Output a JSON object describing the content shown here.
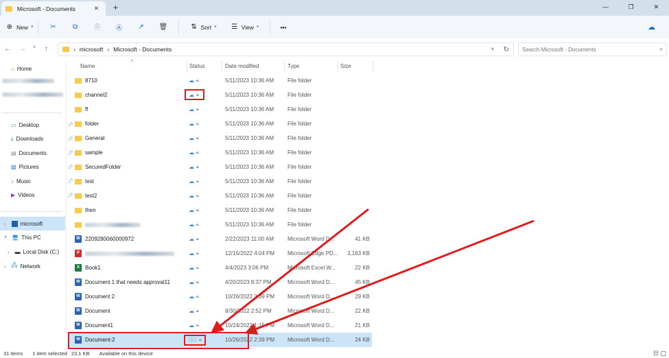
{
  "window": {
    "tab_title": "Microsoft - Documents",
    "new_tab": "+",
    "min": "—",
    "max": "❐",
    "close": "✕"
  },
  "toolbar": {
    "new": "New",
    "sort": "Sort",
    "view": "View",
    "more": "•••"
  },
  "address": {
    "crumbs": [
      "microsoft",
      "Microsoft - Documents"
    ],
    "search_placeholder": "Search Microsoft - Documents"
  },
  "sidebar": {
    "home": "Home",
    "quick": [
      {
        "label": "Desktop",
        "color": "#2a8ad8"
      },
      {
        "label": "Downloads",
        "color": "#1a9e6a"
      },
      {
        "label": "Documents",
        "color": "#7a8a9c"
      },
      {
        "label": "Pictures",
        "color": "#1f6fd0"
      },
      {
        "label": "Music",
        "color": "#e0603a"
      },
      {
        "label": "Videos",
        "color": "#8a3fd0"
      }
    ],
    "microsoft": "microsoft",
    "thispc": "This PC",
    "localdisk": "Local Disk (C:)",
    "network": "Network"
  },
  "columns": {
    "name": "Name",
    "status": "Status",
    "date": "Date modified",
    "type": "Type",
    "size": "Size"
  },
  "files": [
    {
      "name": "8710",
      "date": "5/11/2023 10:36 AM",
      "type": "File folder",
      "size": "",
      "kind": "folder"
    },
    {
      "name": "channel2",
      "date": "5/11/2023 10:36 AM",
      "type": "File folder",
      "size": "",
      "kind": "folder"
    },
    {
      "name": "ff",
      "date": "5/11/2023 10:36 AM",
      "type": "File folder",
      "size": "",
      "kind": "folder"
    },
    {
      "name": "folder",
      "date": "5/11/2023 10:36 AM",
      "type": "File folder",
      "size": "",
      "kind": "folder"
    },
    {
      "name": "General",
      "date": "5/11/2023 10:36 AM",
      "type": "File folder",
      "size": "",
      "kind": "folder"
    },
    {
      "name": "sample",
      "date": "5/11/2023 10:36 AM",
      "type": "File folder",
      "size": "",
      "kind": "folder"
    },
    {
      "name": "SecuredFolder",
      "date": "5/11/2023 10:36 AM",
      "type": "File folder",
      "size": "",
      "kind": "folder"
    },
    {
      "name": "test",
      "date": "5/11/2023 10:36 AM",
      "type": "File folder",
      "size": "",
      "kind": "folder"
    },
    {
      "name": "test2",
      "date": "5/11/2023 10:36 AM",
      "type": "File folder",
      "size": "",
      "kind": "folder"
    },
    {
      "name": "then",
      "date": "5/11/2023 10:36 AM",
      "type": "File folder",
      "size": "",
      "kind": "folder"
    },
    {
      "name": "",
      "date": "5/11/2023 10:36 AM",
      "type": "File folder",
      "size": "",
      "kind": "folder"
    },
    {
      "name": "2209280060000972",
      "date": "2/22/2023 11:00 AM",
      "type": "Microsoft Word D...",
      "size": "41 KB",
      "kind": "word"
    },
    {
      "name": "",
      "date": "12/15/2022 4:04 PM",
      "type": "Microsoft Edge PD...",
      "size": "3,163 KB",
      "kind": "pdf"
    },
    {
      "name": "Book1",
      "date": "4/4/2023 3:06 PM",
      "type": "Microsoft Excel W...",
      "size": "22 KB",
      "kind": "excel"
    },
    {
      "name": "Document 1 that needs approval11",
      "date": "4/20/2023 8:37 PM",
      "type": "Microsoft Word D...",
      "size": "45 KB",
      "kind": "word"
    },
    {
      "name": "Document 2",
      "date": "10/26/2022 2:39 PM",
      "type": "Microsoft Word D...",
      "size": "29 KB",
      "kind": "word"
    },
    {
      "name": "Document",
      "date": "8/30/2022 2:52 PM",
      "type": "Microsoft Word D...",
      "size": "22 KB",
      "kind": "word"
    },
    {
      "name": "Document1",
      "date": "10/24/2022 1:15 PM",
      "type": "Microsoft Word D...",
      "size": "21 KB",
      "kind": "word"
    },
    {
      "name": "Document-2",
      "date": "10/26/2022 2:39 PM",
      "type": "Microsoft Word D...",
      "size": "24 KB",
      "kind": "word",
      "selected": true,
      "synced": true
    }
  ],
  "statusbar": {
    "items": "31 items",
    "selected": "1 item selected",
    "size": "23.1 KB",
    "availability": "Available on this device"
  },
  "colors": {
    "accent": "#0067c0",
    "annotation": "#e01b1b",
    "selection": "#cce4f7"
  }
}
